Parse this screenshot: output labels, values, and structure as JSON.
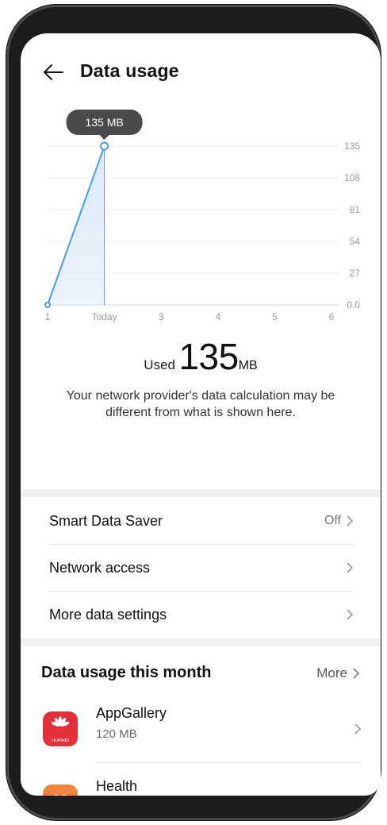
{
  "header": {
    "title": "Data usage"
  },
  "chart_data": {
    "type": "area",
    "x_ticks": [
      "1",
      "Today",
      "3",
      "4",
      "5",
      "6"
    ],
    "y_ticks": [
      "135",
      "108",
      "81",
      "54",
      "27",
      "0.0"
    ],
    "ylim": [
      0,
      135
    ],
    "series": [
      {
        "x": [
          0,
          1
        ],
        "values": [
          0,
          135
        ]
      }
    ],
    "tooltip": "135 MB",
    "line_color": "#4a9be8",
    "fill_color": "#dbeaf9",
    "grid": true
  },
  "usage": {
    "label": "Used",
    "value": "135",
    "unit": "MB"
  },
  "note": "Your network provider's data calculation may be different from what is shown here.",
  "settings": [
    {
      "label": "Smart Data Saver",
      "value": "Off"
    },
    {
      "label": "Network access",
      "value": ""
    },
    {
      "label": "More data settings",
      "value": ""
    }
  ],
  "month": {
    "title": "Data usage this month",
    "more": "More",
    "apps": [
      {
        "name": "AppGallery",
        "size": "120 MB",
        "icon": "huawei-appgallery-icon",
        "icon_text": "HUAWEI",
        "color": "#e5303a"
      },
      {
        "name": "Health",
        "size": "",
        "icon": "health-heart-icon",
        "color": "#f2853d"
      }
    ]
  }
}
